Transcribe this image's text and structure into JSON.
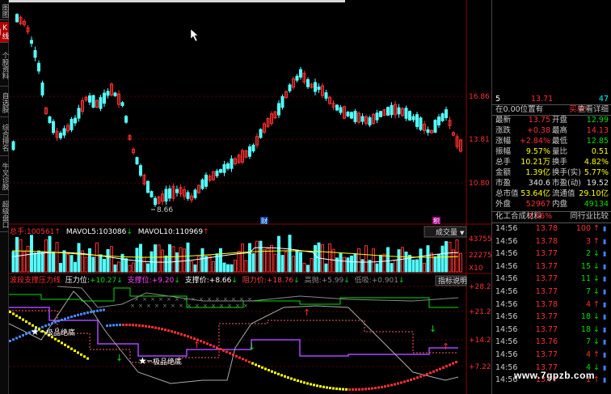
{
  "leftnav": {
    "items": [
      {
        "label": "图图",
        "active": false
      },
      {
        "label": "K线图",
        "active": true
      },
      {
        "label": "个股资料",
        "active": false
      },
      {
        "label": "自选股",
        "active": false
      },
      {
        "label": "综合排名",
        "active": false
      },
      {
        "label": "牛叉诊股",
        "active": false
      },
      {
        "label": "超级盘口",
        "active": false
      }
    ]
  },
  "chart": {
    "price_axis": [
      "16.86",
      "13.81",
      "10.80"
    ],
    "low_marker": "8.66",
    "event_tags": [
      "财",
      "积"
    ],
    "volume_header": {
      "total_label": "总手:",
      "total_value": "100561",
      "mavol5_label": "MAVOL5:",
      "mavol5_value": "103086",
      "mavol10_label": "MAVOL10:",
      "mavol10_value": "110969"
    },
    "volume_selector": "成交量",
    "volume_axis": [
      "43755",
      "22275",
      "X10"
    ],
    "indicator_header": {
      "name": "波段支撑压力线",
      "pressure_label": "压力位:",
      "pressure_value": "+10.27",
      "support_label": "支撑位:",
      "support_value": "+9.20",
      "support_price_label": "支撑价:",
      "support_price_value": "+8.66",
      "resist_price_label": "阻力价:",
      "resist_price_value": "+18.76",
      "high_label": "高抛:",
      "high_value": "+5.99",
      "low_label": "低吸:",
      "low_value": "+0.901"
    },
    "indicator_help": "指标说明",
    "indicator_axis": [
      "+28.23",
      "+21.23",
      "+14.22",
      "+7.22"
    ],
    "signal_labels": [
      "极品绝底",
      "极品绝底"
    ]
  },
  "quote": {
    "header": {
      "left": "5",
      "price": "13.71",
      "right": "47"
    },
    "position_label": "在0.00位置有",
    "buy_label": "买单!",
    "detail_label": "查看详细",
    "rows": [
      {
        "l1": "最新",
        "v1": "13.75",
        "c1": "red",
        "l2": "开盘",
        "v2": "12.99",
        "c2": "green"
      },
      {
        "l1": "涨跌",
        "v1": "+0.38",
        "c1": "red",
        "l2": "最高",
        "v2": "14.13",
        "c2": "red"
      },
      {
        "l1": "涨幅",
        "v1": "+2.84%",
        "c1": "red",
        "l2": "最低",
        "v2": "12.85",
        "c2": "green"
      },
      {
        "l1": "振幅",
        "v1": "9.57%",
        "c1": "yellow",
        "l2": "量比",
        "v2": "0.51",
        "c2": "yellow"
      },
      {
        "l1": "总手",
        "v1": "10.21万",
        "c1": "yellow",
        "l2": "换手",
        "v2": "4.82%",
        "c2": "yellow"
      },
      {
        "l1": "金额",
        "v1": "1.39亿",
        "c1": "yellow",
        "l2": "换手(实)",
        "v2": "5.77%",
        "c2": "yellow"
      },
      {
        "l1": "市盈",
        "v1": "340.6",
        "c1": "white",
        "l2": "市盈(动)",
        "v2": "19.52",
        "c2": "white"
      },
      {
        "l1": "总市值",
        "v1": "53.64亿",
        "c1": "yellow",
        "l2": "流通值",
        "v2": "29.10亿",
        "c2": "yellow"
      },
      {
        "l1": "外盘",
        "v1": "52967",
        "c1": "red",
        "l2": "内盘",
        "v2": "49134",
        "c2": "green"
      }
    ],
    "sector": {
      "name": "化工合成材料",
      "change": "2.56%",
      "compare": "同行业比较"
    },
    "ticks": [
      {
        "time": "14:56",
        "price": "13.78",
        "vol": "100",
        "dir": "up",
        "pc": "red"
      },
      {
        "time": "14:56",
        "price": "13.78",
        "vol": "3",
        "dir": "up",
        "pc": "red"
      },
      {
        "time": "14:56",
        "price": "13.77",
        "vol": "2",
        "dir": "down",
        "pc": "red"
      },
      {
        "time": "14:56",
        "price": "13.77",
        "vol": "15",
        "dir": "down",
        "pc": "red"
      },
      {
        "time": "14:56",
        "price": "13.77",
        "vol": "11",
        "dir": "down",
        "pc": "red"
      },
      {
        "time": "14:56",
        "price": "13.77",
        "vol": "7",
        "dir": "down",
        "pc": "red"
      },
      {
        "time": "14:56",
        "price": "13.78",
        "vol": "4",
        "dir": "up",
        "pc": "red"
      },
      {
        "time": "14:56",
        "price": "13.77",
        "vol": "18",
        "dir": "down",
        "pc": "red"
      },
      {
        "time": "14:56",
        "price": "13.77",
        "vol": "18",
        "dir": "down",
        "pc": "red"
      },
      {
        "time": "14:56",
        "price": "13.76",
        "vol": "7",
        "dir": "down",
        "pc": "red"
      },
      {
        "time": "14:56",
        "price": "13.77",
        "vol": "4",
        "dir": "up",
        "pc": "red"
      },
      {
        "time": "14:56",
        "price": "13.77",
        "vol": "4",
        "dir": "down",
        "pc": "red"
      },
      {
        "time": "14:56",
        "price": "13.77",
        "vol": "1",
        "dir": "up",
        "pc": "red"
      }
    ]
  },
  "watermark": "www.7gpzb.com"
}
